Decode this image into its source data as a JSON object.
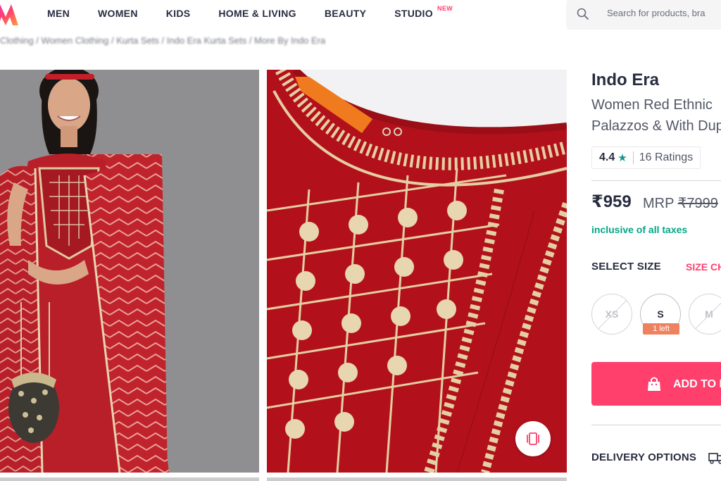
{
  "header": {
    "nav": [
      {
        "label": "MEN"
      },
      {
        "label": "WOMEN"
      },
      {
        "label": "KIDS"
      },
      {
        "label": "HOME & LIVING"
      },
      {
        "label": "BEAUTY"
      },
      {
        "label": "STUDIO",
        "badge": "NEW"
      }
    ],
    "search_placeholder": "Search for products, bra"
  },
  "breadcrumb": "Clothing / Women Clothing / Kurta Sets / Indo Era Kurta Sets / More By Indo Era",
  "product": {
    "brand": "Indo Era",
    "title_line1": "Women Red Ethnic",
    "title_line2": "Palazzos & With Dup",
    "rating_value": "4.4",
    "rating_star": "★",
    "rating_count": "16 Ratings",
    "price": "₹959",
    "mrp_label": "MRP",
    "mrp_value": "₹7999",
    "tax_note": "inclusive of all taxes",
    "select_size_label": "SELECT SIZE",
    "size_chart_label": "SIZE CH",
    "sizes": [
      {
        "label": "XS",
        "available": false
      },
      {
        "label": "S",
        "available": true,
        "stock_note": "1 left"
      },
      {
        "label": "M",
        "available": false
      }
    ],
    "add_to_bag_label": "ADD TO B",
    "delivery_label": "DELIVERY OPTIONS"
  },
  "colors": {
    "accent": "#ff3f6c",
    "tax_green": "#03a685",
    "rating_star": "#14958f",
    "kurta_red": "#b2111c"
  },
  "icons": [
    "myntra-logo-icon",
    "search-icon",
    "similar-products-icon",
    "bag-icon",
    "truck-icon"
  ]
}
